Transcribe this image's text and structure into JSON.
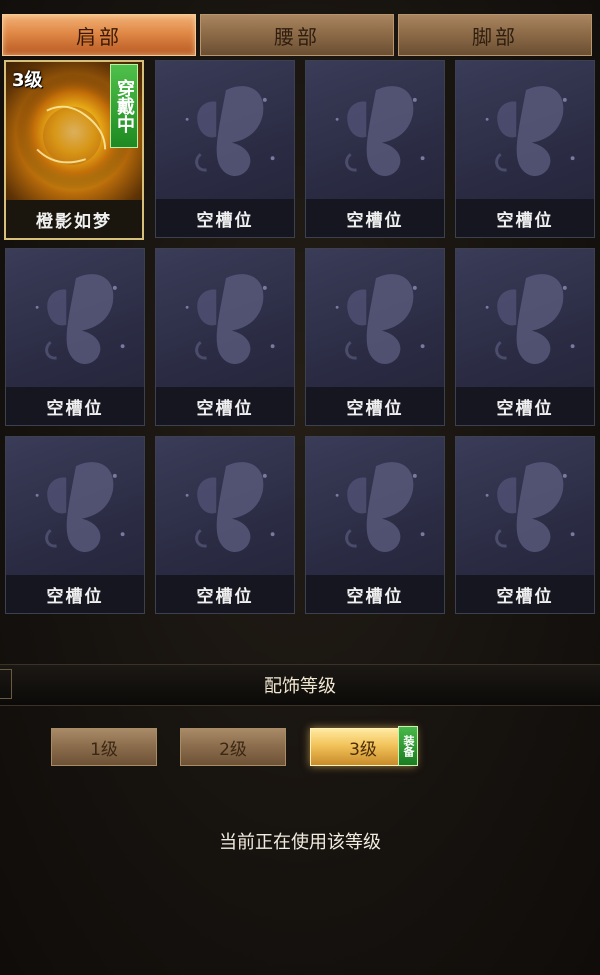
{
  "tabs": [
    {
      "label": "肩部",
      "active": true
    },
    {
      "label": "腰部",
      "active": false
    },
    {
      "label": "脚部",
      "active": false
    }
  ],
  "slots": [
    {
      "label": "橙影如梦",
      "level": "3级",
      "wearing": "穿戴中",
      "equipped": true
    },
    {
      "label": "空槽位"
    },
    {
      "label": "空槽位"
    },
    {
      "label": "空槽位"
    },
    {
      "label": "空槽位"
    },
    {
      "label": "空槽位"
    },
    {
      "label": "空槽位"
    },
    {
      "label": "空槽位"
    },
    {
      "label": "空槽位"
    },
    {
      "label": "空槽位"
    },
    {
      "label": "空槽位"
    },
    {
      "label": "空槽位"
    }
  ],
  "section": {
    "title": "配饰等级"
  },
  "levels": [
    {
      "label": "1级",
      "active": false
    },
    {
      "label": "2级",
      "active": false
    },
    {
      "label": "3级",
      "active": true
    }
  ],
  "equip_badge": "装备",
  "status_text": "当前正在使用该等级",
  "icons": {
    "empty_slot": "butterfly-icon",
    "equipped_item": "golden-orb-icon"
  }
}
